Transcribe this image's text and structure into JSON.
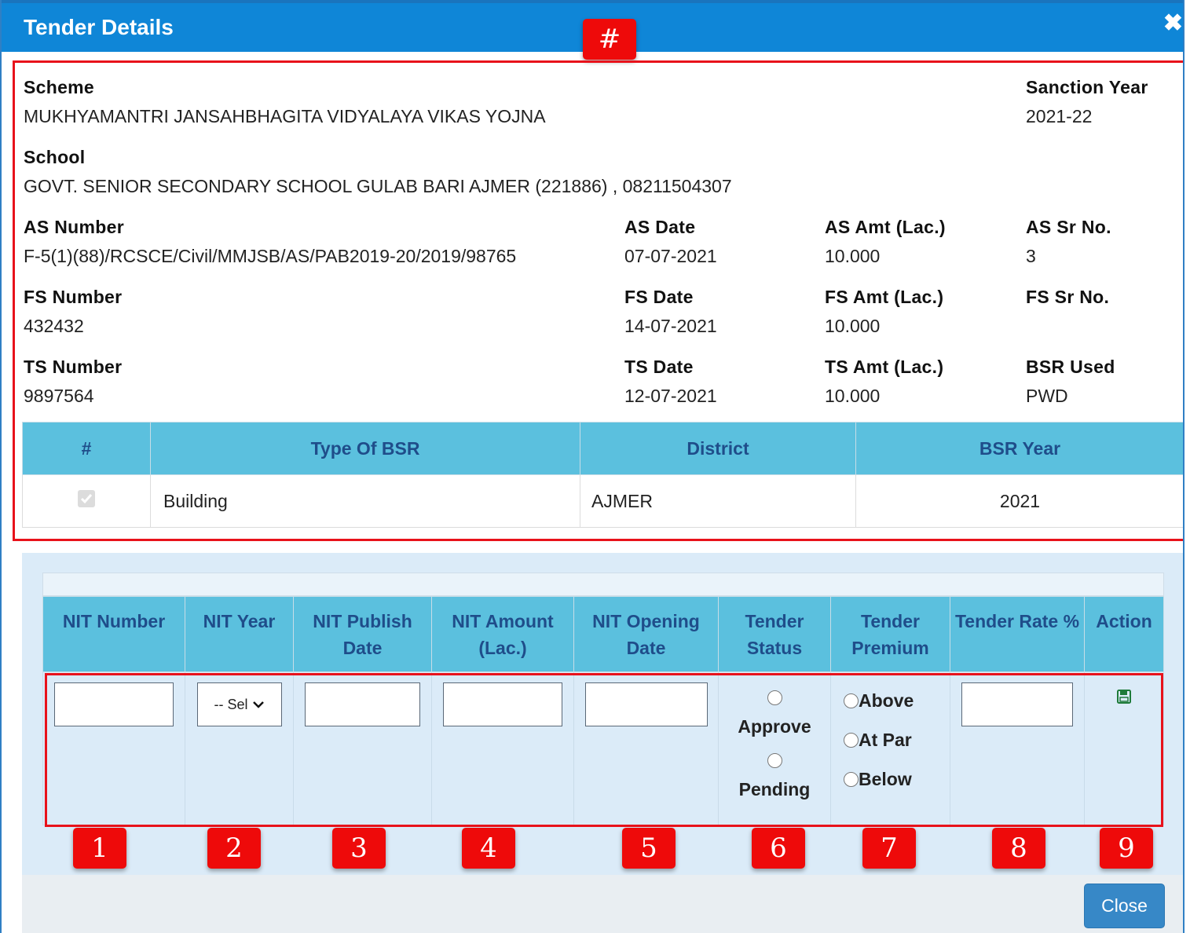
{
  "header": {
    "title": "Tender Details",
    "close_glyph": "✖"
  },
  "scheme": {
    "label": "Scheme",
    "value": "MUKHYAMANTRI JANSAHBHAGITA VIDYALAYA VIKAS YOJNA"
  },
  "sanction_year": {
    "label": "Sanction Year",
    "value": "2021-22"
  },
  "school": {
    "label": "School",
    "value": "GOVT. SENIOR SECONDARY SCHOOL GULAB BARI AJMER (221886) , 08211504307"
  },
  "as": {
    "number_label": "AS Number",
    "number": "F-5(1)(88)/RCSCE/Civil/MMJSB/AS/PAB2019-20/2019/98765",
    "date_label": "AS Date",
    "date": "07-07-2021",
    "amt_label": "AS Amt (Lac.)",
    "amt": "10.000",
    "sr_label": "AS Sr No.",
    "sr": "3"
  },
  "fs": {
    "number_label": "FS Number",
    "number": "432432",
    "date_label": "FS Date",
    "date": "14-07-2021",
    "amt_label": "FS Amt (Lac.)",
    "amt": "10.000",
    "sr_label": "FS Sr No.",
    "sr": ""
  },
  "ts": {
    "number_label": "TS Number",
    "number": "9897564",
    "date_label": "TS Date",
    "date": "12-07-2021",
    "amt_label": "TS Amt (Lac.)",
    "amt": "10.000",
    "bsr_label": "BSR Used",
    "bsr": "PWD"
  },
  "bsr_table": {
    "headers": [
      "#",
      "Type Of BSR",
      "District",
      "BSR Year"
    ],
    "row": {
      "checked": true,
      "type": "Building",
      "district": "AJMER",
      "year": "2021"
    }
  },
  "nit_table": {
    "headers": [
      "NIT Number",
      "NIT Year",
      "NIT Publish Date",
      "NIT Amount (Lac.)",
      "NIT Opening Date",
      "Tender Status",
      "Tender Premium",
      "Tender Rate %",
      "Action"
    ],
    "year_select_value": "-- Select --",
    "status_options": [
      "Approve",
      "Pending"
    ],
    "premium_options": [
      "Above",
      "At Par",
      "Below"
    ],
    "action_icon": "save-icon"
  },
  "badges": {
    "hash": "#",
    "numbers": [
      "1",
      "2",
      "3",
      "4",
      "5",
      "6",
      "7",
      "8",
      "9"
    ]
  },
  "footer": {
    "close_label": "Close"
  },
  "colors": {
    "header": "#0f86d7",
    "table_header": "#5bc0de",
    "table_header_text": "#1f4d8a",
    "annotation_red": "#e8121b",
    "close_button": "#3788c7"
  }
}
